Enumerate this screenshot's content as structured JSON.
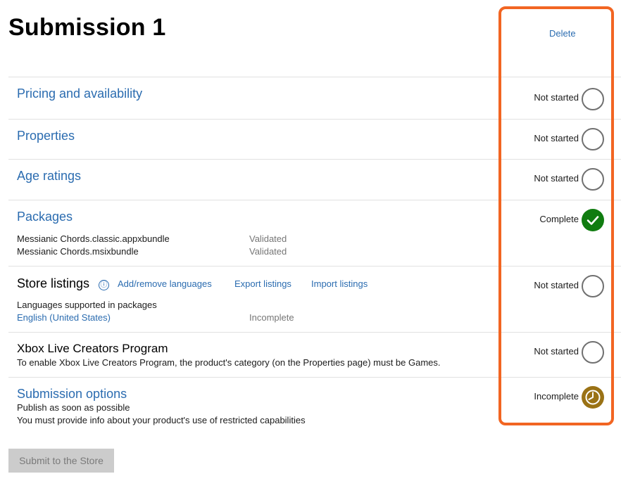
{
  "header": {
    "title": "Submission 1",
    "delete_label": "Delete"
  },
  "sections": {
    "pricing": {
      "title": "Pricing and availability",
      "status": "Not started"
    },
    "properties": {
      "title": "Properties",
      "status": "Not started"
    },
    "age_ratings": {
      "title": "Age ratings",
      "status": "Not started"
    },
    "packages": {
      "title": "Packages",
      "status": "Complete",
      "files": [
        {
          "name": "Messianic Chords.classic.appxbundle",
          "state": "Validated"
        },
        {
          "name": "Messianic Chords.msixbundle",
          "state": "Validated"
        }
      ]
    },
    "store_listings": {
      "title": "Store listings",
      "status": "Not started",
      "info_icon": "ⓘ",
      "add_remove_label": "Add/remove languages",
      "export_label": "Export listings",
      "import_label": "Import listings",
      "languages_heading": "Languages supported in packages",
      "language": "English (United States)",
      "language_state": "Incomplete"
    },
    "xbox": {
      "title": "Xbox Live Creators Program",
      "status": "Not started",
      "description": "To enable Xbox Live Creators Program, the product's category (on the Properties page) must be Games."
    },
    "submission_options": {
      "title": "Submission options",
      "status": "Incomplete",
      "line1": "Publish as soon as possible",
      "line2": "You must provide info about your product's use of restricted capabilities"
    }
  },
  "footer": {
    "submit_label": "Submit to the Store"
  },
  "colors": {
    "link": "#2b6cb0",
    "complete": "#107c10",
    "incomplete": "#9a7215",
    "highlight": "#f26522"
  }
}
